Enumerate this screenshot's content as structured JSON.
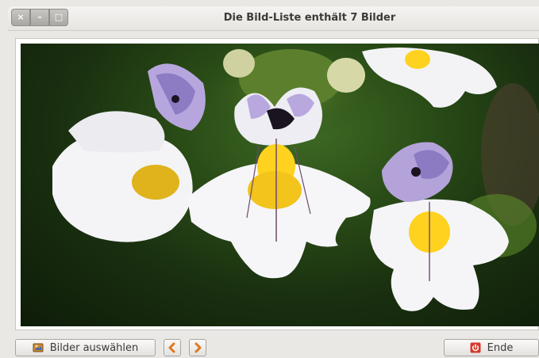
{
  "window": {
    "title": "Die Bild-Liste enthält 7 Bilder",
    "controls": {
      "close": "×",
      "minimize": "–",
      "maximize": "□"
    }
  },
  "viewer": {
    "image_subject": "white and purple eyebright flowers"
  },
  "toolbar": {
    "select_label": "Bilder auswählen",
    "select_icon": "image-folder-icon",
    "prev_icon": "chevron-left-icon",
    "next_icon": "chevron-right-icon",
    "end_label": "Ende",
    "end_icon": "power-icon"
  },
  "colors": {
    "accent_orange": "#e0781c",
    "end_red": "#d33a2c"
  }
}
